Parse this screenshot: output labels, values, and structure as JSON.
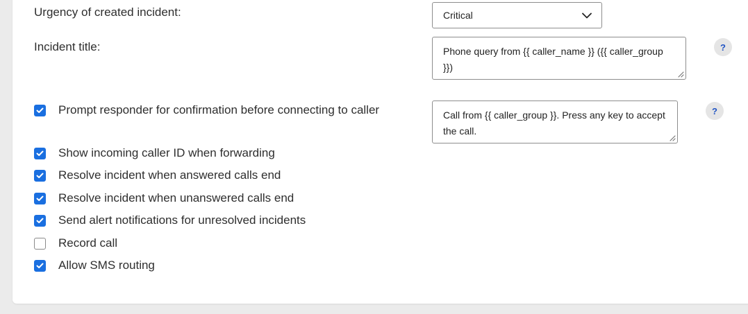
{
  "form": {
    "urgency_label": "Urgency of created incident:",
    "urgency_value": "Critical",
    "incident_title_label": "Incident title:",
    "incident_title_value": "Phone query from {{ caller_name }} ({{ caller_group }})",
    "confirmation_message_value": "Call from {{ caller_group }}. Press any key to accept the call.",
    "help_glyph": "?"
  },
  "checkboxes": [
    {
      "label": "Prompt responder for confirmation before connecting to caller",
      "checked": true
    },
    {
      "label": "Show incoming caller ID when forwarding",
      "checked": true
    },
    {
      "label": "Resolve incident when answered calls end",
      "checked": true
    },
    {
      "label": "Resolve incident when unanswered calls end",
      "checked": true
    },
    {
      "label": "Send alert notifications for unresolved incidents",
      "checked": true
    },
    {
      "label": "Record call",
      "checked": false
    },
    {
      "label": "Allow SMS routing",
      "checked": true
    }
  ],
  "colors": {
    "accent": "#1a6fe0",
    "help_text": "#2255c4",
    "help_bg": "#e5e5e5",
    "page_bg": "#ebebeb",
    "card_bg": "#ffffff"
  },
  "icons": {
    "dropdown": "chevron-down-icon",
    "check": "check-icon",
    "resize": "resize-grip-icon"
  }
}
